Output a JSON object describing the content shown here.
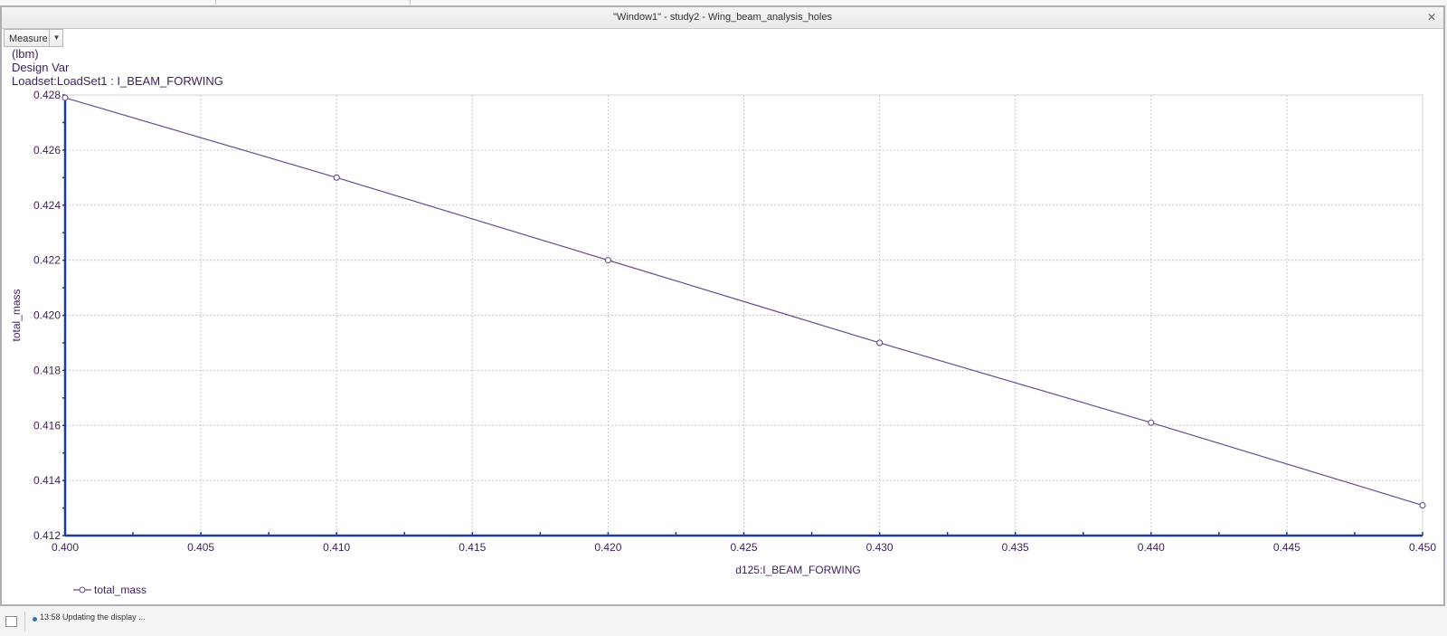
{
  "window": {
    "title": "\"Window1\" - study2 - Wing_beam_analysis_holes",
    "close_icon": "close-icon"
  },
  "toolbar": {
    "measure_label": "Measure",
    "measure_dropdown_icon": "chevron-down-icon"
  },
  "header": {
    "unit": "(lbm)",
    "design_var": "Design Var",
    "loadset": "Loadset:LoadSet1 :  I_BEAM_FORWING"
  },
  "chart_data": {
    "type": "line",
    "xlabel": "d125:I_BEAM_FORWING",
    "ylabel": "total_mass",
    "xlim": [
      0.4,
      0.45
    ],
    "ylim": [
      0.412,
      0.428
    ],
    "x_ticks": [
      "0.400",
      "0.405",
      "0.410",
      "0.415",
      "0.420",
      "0.425",
      "0.430",
      "0.435",
      "0.440",
      "0.445",
      "0.450"
    ],
    "y_ticks": [
      "0.412",
      "0.414",
      "0.416",
      "0.418",
      "0.420",
      "0.422",
      "0.424",
      "0.426",
      "0.428"
    ],
    "grid": true,
    "legend_position": "bottom-left",
    "series": [
      {
        "name": "total_mass",
        "color": "#6a4c93",
        "marker": "circle",
        "points": [
          [
            0.4,
            0.4279
          ],
          [
            0.41,
            0.425
          ],
          [
            0.42,
            0.422
          ],
          [
            0.43,
            0.419
          ],
          [
            0.44,
            0.4161
          ],
          [
            0.45,
            0.4131
          ]
        ]
      }
    ]
  },
  "status": {
    "text": "13:58 Updating the display ..."
  }
}
